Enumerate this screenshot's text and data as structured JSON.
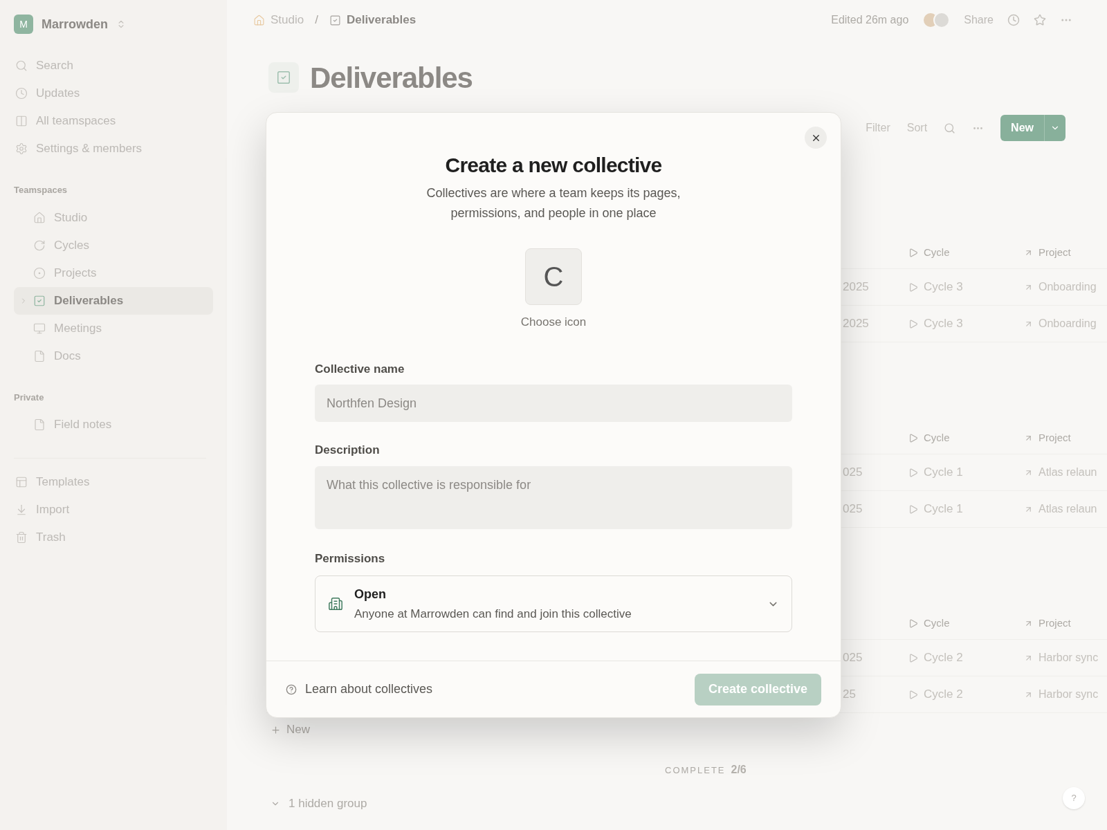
{
  "sidebar": {
    "workspace": {
      "initial": "M",
      "name": "Marrowden"
    },
    "nav": [
      {
        "label": "Search",
        "selected": false
      },
      {
        "label": "Updates",
        "selected": false
      },
      {
        "label": "All teamspaces",
        "selected": false
      },
      {
        "label": "Settings & members",
        "selected": false
      }
    ],
    "sections": [
      {
        "title": "Teamspaces",
        "items": [
          {
            "label": "Studio",
            "selected": false
          },
          {
            "label": "Cycles",
            "selected": false
          },
          {
            "label": "Projects",
            "selected": false
          },
          {
            "label": "Deliverables",
            "selected": true
          },
          {
            "label": "Meetings",
            "selected": false
          },
          {
            "label": "Docs",
            "selected": false
          }
        ]
      },
      {
        "title": "Private",
        "items": [
          {
            "label": "Field notes",
            "selected": false
          }
        ]
      }
    ],
    "footer_items": [
      {
        "label": "Templates",
        "selected": false
      },
      {
        "label": "Import",
        "selected": false
      },
      {
        "label": "Trash",
        "selected": false
      }
    ]
  },
  "topbar": {
    "breadcrumbs": [
      {
        "label": "Studio",
        "current": false
      },
      {
        "label": "Deliverables",
        "current": true
      }
    ],
    "separator": "/",
    "edited": "Edited 26m ago",
    "share": "Share"
  },
  "page": {
    "title": "Deliverables"
  },
  "toolbar": {
    "filter": "Filter",
    "sort": "Sort",
    "new": "New"
  },
  "table": {
    "groups": [
      {
        "columns": [
          "Cycle",
          "Project"
        ],
        "rows": [
          {
            "date": "2025",
            "cycle": "Cycle 3",
            "project": "Onboarding"
          },
          {
            "date": "2025",
            "cycle": "Cycle 3",
            "project": "Onboarding"
          }
        ]
      },
      {
        "columns": [
          "Cycle",
          "Project"
        ],
        "rows": [
          {
            "date": "025",
            "cycle": "Cycle 1",
            "project": "Atlas relaun"
          },
          {
            "date": "025",
            "cycle": "Cycle 1",
            "project": "Atlas relaun"
          }
        ]
      },
      {
        "columns": [
          "Cycle",
          "Project"
        ],
        "rows": [
          {
            "date": "025",
            "cycle": "Cycle 2",
            "project": "Harbor sync"
          },
          {
            "date": "25",
            "cycle": "Cycle 2",
            "project": "Harbor sync"
          }
        ]
      }
    ],
    "add_row": "New",
    "summary": {
      "label": "COMPLETE",
      "value": "2/6"
    },
    "hidden_groups": "1 hidden group"
  },
  "help": "?",
  "modal": {
    "title": "Create a new collective",
    "subtitle": [
      "Collectives are where a team keeps its pages,",
      "permissions, and people in one place"
    ],
    "icon_letter": "C",
    "choose_icon": "Choose icon",
    "name_field": {
      "label": "Collective name",
      "placeholder": "Northfen Design"
    },
    "description_field": {
      "label": "Description",
      "placeholder": "What this collective is responsible for"
    },
    "permissions": {
      "label": "Permissions",
      "title": "Open",
      "description": "Anyone at Marrowden can find and join this collective"
    },
    "learn_link": "Learn about collectives",
    "create_button": {
      "label": "Create collective",
      "disabled": true
    }
  }
}
